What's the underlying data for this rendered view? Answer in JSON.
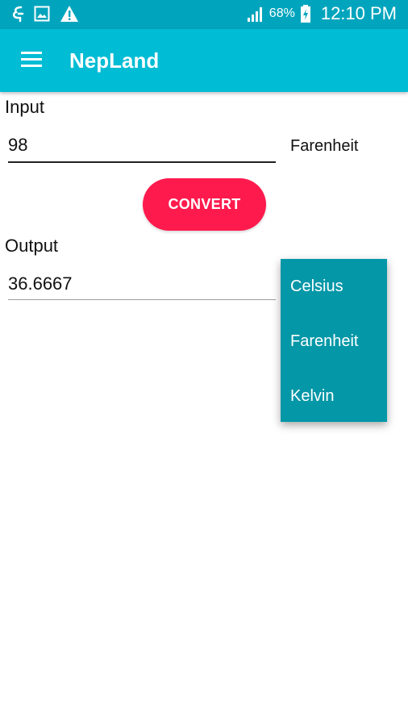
{
  "status_bar": {
    "battery": "68%",
    "time": "12:10 PM",
    "icons": [
      "notification-icon",
      "gallery-icon",
      "warning-icon",
      "signal-icon",
      "battery-charging-icon"
    ]
  },
  "app_bar": {
    "title": "NepLand",
    "menu_icon": "hamburger-menu-icon"
  },
  "input": {
    "label": "Input",
    "value": "98",
    "unit": "Farenheit"
  },
  "convert_button": {
    "label": "CONVERT"
  },
  "output": {
    "label": "Output",
    "value": "36.6667"
  },
  "unit_menu": {
    "options": [
      "Celsius",
      "Farenheit",
      "Kelvin"
    ]
  },
  "colors": {
    "status_bar": "#00a5bd",
    "app_bar": "#00bcd4",
    "accent": "#ff1a4e",
    "dropdown": "#0397a7"
  }
}
